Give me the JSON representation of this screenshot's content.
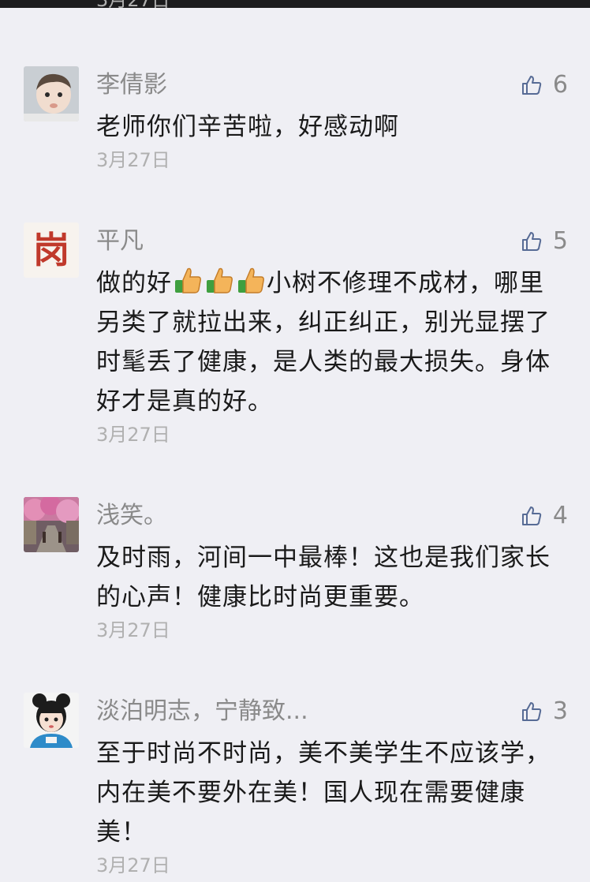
{
  "top_partial_date": "3月27日",
  "comments": [
    {
      "name": "李倩影",
      "likes": "6",
      "content": "老师你们辛苦啦，好感动啊",
      "date": "3月27日",
      "avatar_icon": "baby-photo-avatar"
    },
    {
      "name": "平凡",
      "likes": "5",
      "content_prefix": "做的好",
      "emoji": "thumbs-up-emoji",
      "content_suffix": "小树不修理不成材，哪里另类了就拉出来，纠正纠正，别光显摆了时髦丢了健康，是人类的最大损失。身体好才是真的好。",
      "date": "3月27日",
      "avatar_text": "岗"
    },
    {
      "name": "浅笑。",
      "likes": "4",
      "content": "及时雨，河间一中最棒！这也是我们家长的心声！健康比时尚更重要。",
      "date": "3月27日",
      "avatar_icon": "pink-tree-street-avatar"
    },
    {
      "name": "淡泊明志，宁静致...",
      "likes": "3",
      "content": "至于时尚不时尚，美不美学生不应该学，内在美不要外在美！国人现在需要健康美！",
      "date": "3月27日",
      "avatar_icon": "cartoon-girl-avatar"
    }
  ],
  "colors": {
    "background": "#efeff4",
    "name": "#8a8a8a",
    "date": "#b0b0b0",
    "text": "#1a1a1a"
  }
}
